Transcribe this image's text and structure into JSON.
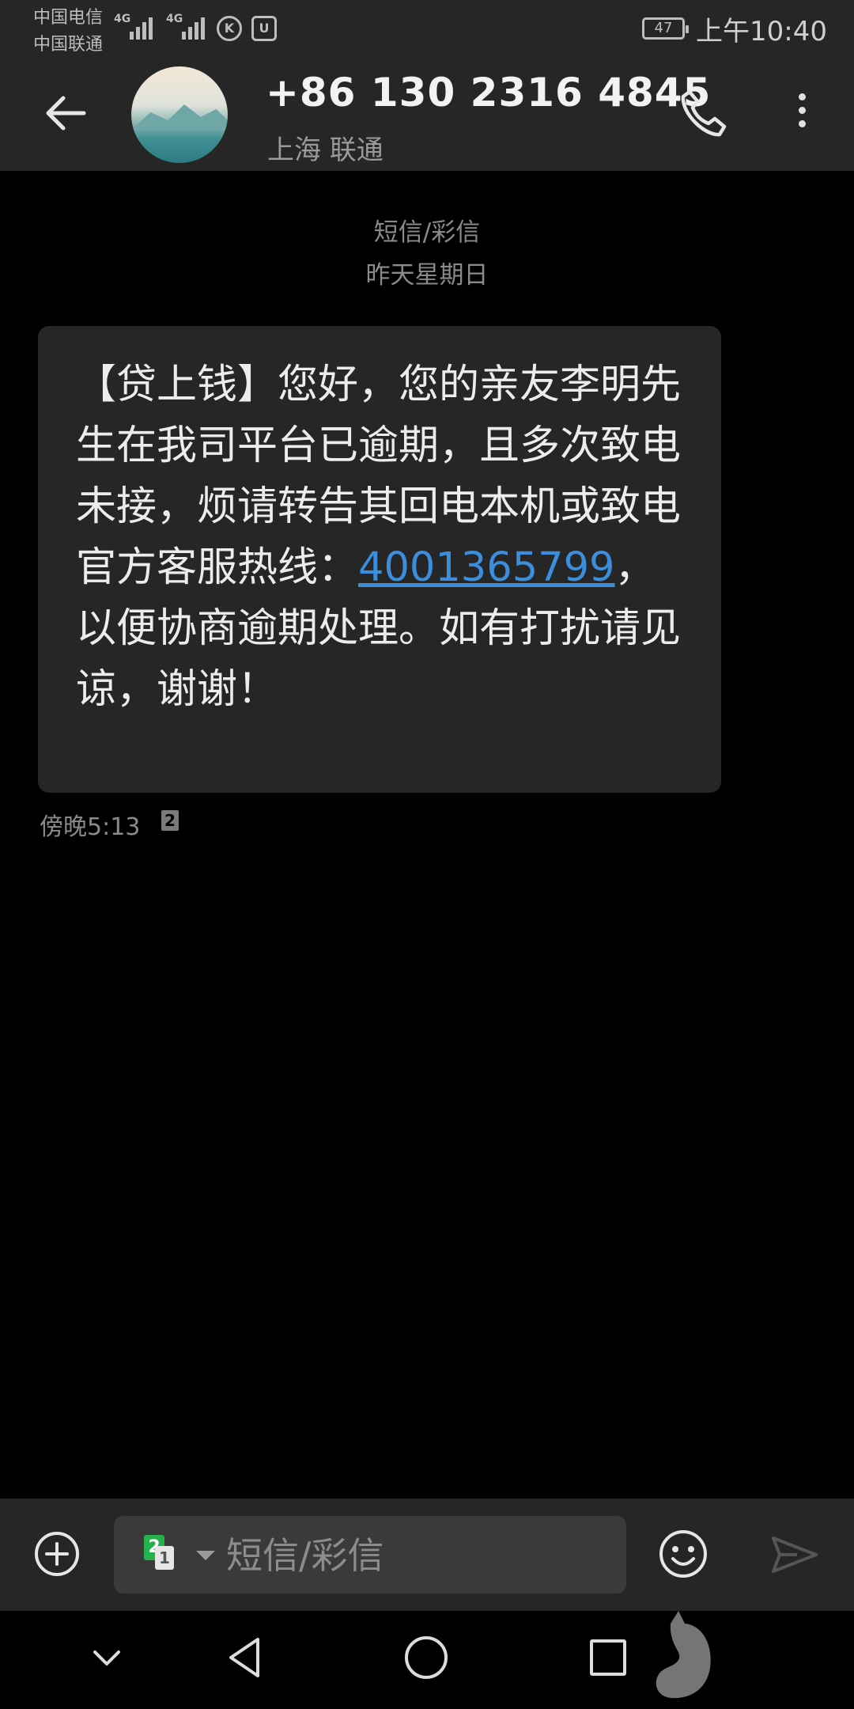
{
  "status_bar": {
    "carrier_1": "中国电信",
    "carrier_2": "中国联通",
    "net_1": "4G",
    "net_2": "4G",
    "battery": "47",
    "time": "上午10:40"
  },
  "header": {
    "contact_number": "+86 130 2316 4845",
    "contact_location": "上海 联通"
  },
  "thread": {
    "message_type": "短信/彩信",
    "date_label": "昨天星期日"
  },
  "message": {
    "text_before_link": "【贷上钱】您好，您的亲友李明先生在我司平台已逾期，且多次致电未接，烦请转告其回电本机或致电官方客服热线：",
    "link": "4001365799",
    "text_after_link": "，以便协商逾期处理。如有打扰请见谅，谢谢！",
    "time": "傍晚5:13",
    "sim_badge": "2"
  },
  "composer": {
    "sim_primary": "2",
    "sim_secondary": "1",
    "placeholder": "短信/彩信"
  },
  "colors": {
    "link": "#3b8edb",
    "sim_green": "#26b14c",
    "bar_bg": "#262626"
  }
}
